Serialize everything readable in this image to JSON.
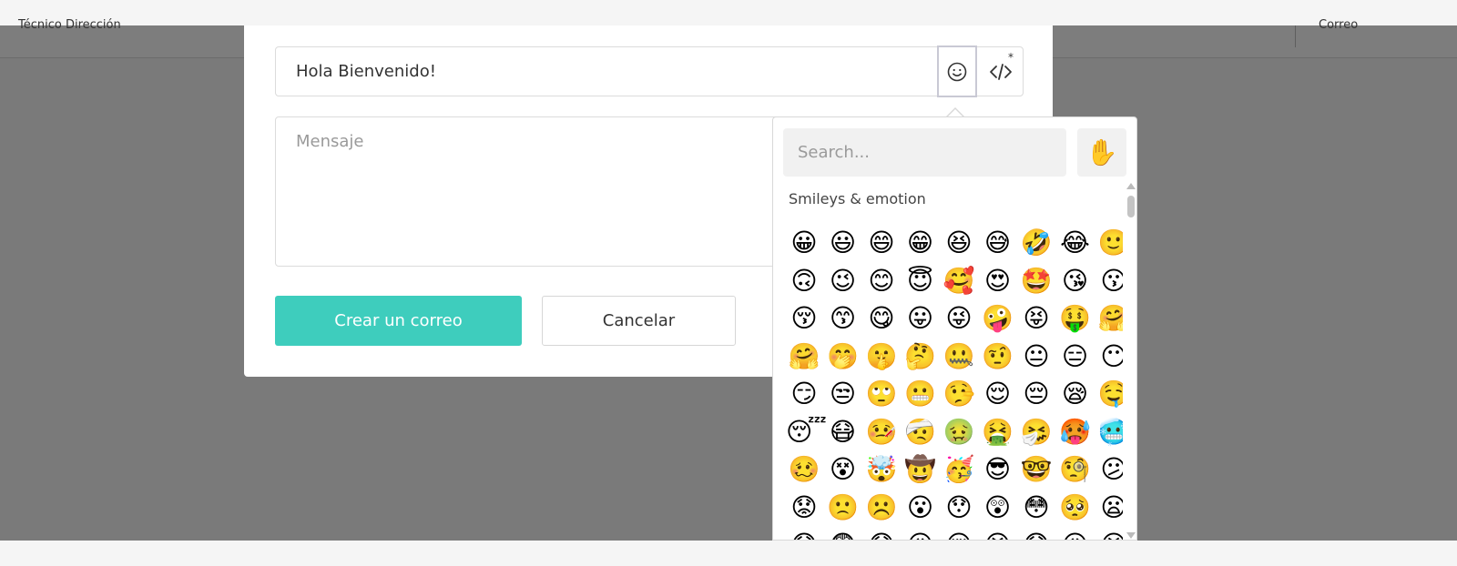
{
  "header": {
    "left_text": "Técnico Dirección",
    "right_text": "Correo"
  },
  "form": {
    "subject_value": "Hola Bienvenido!",
    "message_placeholder": "Mensaje",
    "create_label": "Crear un correo",
    "cancel_label": "Cancelar",
    "code_star": "*"
  },
  "picker": {
    "search_placeholder": "Search...",
    "skin_tone_emoji": "✋",
    "category_title": "Smileys & emotion",
    "emojis": [
      [
        "😀",
        "😃",
        "😄",
        "😁",
        "😆",
        "😅",
        "🤣",
        "😂",
        "🙂"
      ],
      [
        "🙃",
        "😉",
        "😊",
        "😇",
        "🥰",
        "😍",
        "🤩",
        "😘",
        "😗"
      ],
      [
        "😚",
        "😙",
        "😋",
        "😛",
        "😜",
        "🤪",
        "😝",
        "🤑",
        "🤗"
      ],
      [
        "🤗",
        "🤭",
        "🤫",
        "🤔",
        "🤐",
        "🤨",
        "😐",
        "😑",
        "😶"
      ],
      [
        "😏",
        "😒",
        "🙄",
        "😬",
        "🤥",
        "😌",
        "😔",
        "😪",
        "🤤"
      ],
      [
        "😴",
        "😷",
        "🤒",
        "🤕",
        "🤢",
        "🤮",
        "🤧",
        "🥵",
        "🥶"
      ],
      [
        "🥴",
        "😵",
        "🤯",
        "🤠",
        "🥳",
        "😎",
        "🤓",
        "🧐",
        "😕"
      ],
      [
        "😟",
        "🙁",
        "☹️",
        "😮",
        "😯",
        "😲",
        "😳",
        "🥺",
        "😦"
      ],
      [
        "😧",
        "😨",
        "😰",
        "😥",
        "😢",
        "😭",
        "😱",
        "😖",
        "😣"
      ]
    ]
  }
}
